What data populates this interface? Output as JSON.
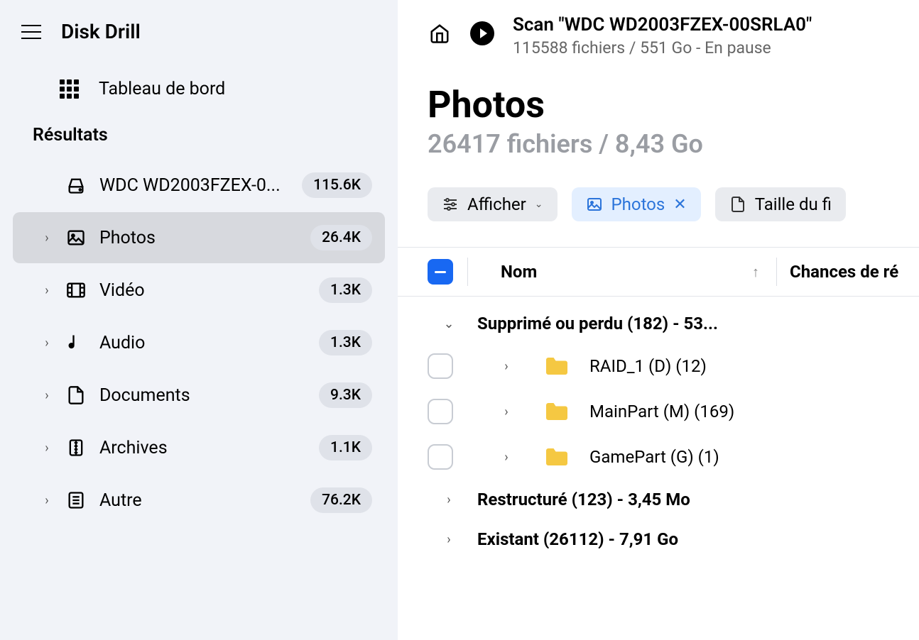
{
  "app": {
    "title": "Disk Drill"
  },
  "sidebar": {
    "dashboard_label": "Tableau de bord",
    "section_title": "Résultats",
    "items": [
      {
        "label": "WDC WD2003FZEX-0...",
        "badge": "115.6K",
        "icon": "disk"
      },
      {
        "label": "Photos",
        "badge": "26.4K",
        "icon": "image",
        "active": true
      },
      {
        "label": "Vidéo",
        "badge": "1.3K",
        "icon": "video"
      },
      {
        "label": "Audio",
        "badge": "1.3K",
        "icon": "audio"
      },
      {
        "label": "Documents",
        "badge": "9.3K",
        "icon": "document"
      },
      {
        "label": "Archives",
        "badge": "1.1K",
        "icon": "archive"
      },
      {
        "label": "Autre",
        "badge": "76.2K",
        "icon": "other"
      }
    ]
  },
  "header": {
    "scan_title": "Scan \"WDC WD2003FZEX-00SRLA0\"",
    "scan_subtitle": "115588 fichiers / 551 Go - En pause"
  },
  "page": {
    "title": "Photos",
    "subtitle": "26417 fichiers / 8,43 Go"
  },
  "filters": {
    "display_label": "Afficher",
    "active_label": "Photos",
    "size_label": "Taille du fi"
  },
  "table": {
    "col_name": "Nom",
    "col_chances": "Chances de ré"
  },
  "groups": [
    {
      "label": "Supprimé ou perdu (182) - 53...",
      "expanded": true
    },
    {
      "label": "Restructuré (123) - 3,45 Mo",
      "expanded": false
    },
    {
      "label": "Existant (26112) - 7,91 Go",
      "expanded": false
    }
  ],
  "folders": [
    {
      "label": "RAID_1 (D) (12)"
    },
    {
      "label": "MainPart (M) (169)"
    },
    {
      "label": "GamePart (G) (1)"
    }
  ]
}
